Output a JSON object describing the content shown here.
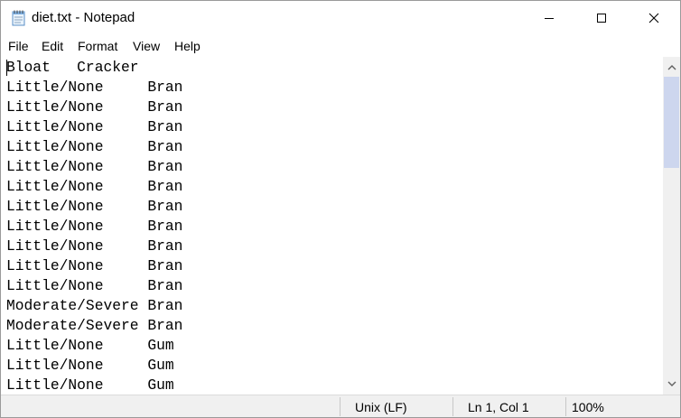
{
  "window": {
    "title": "diet.txt - Notepad",
    "controls": {
      "minimize": "minimize",
      "maximize": "maximize",
      "close": "close"
    }
  },
  "menu": [
    "File",
    "Edit",
    "Format",
    "View",
    "Help"
  ],
  "document": {
    "lines": [
      "Bloat   Cracker",
      "Little/None     Bran",
      "Little/None     Bran",
      "Little/None     Bran",
      "Little/None     Bran",
      "Little/None     Bran",
      "Little/None     Bran",
      "Little/None     Bran",
      "Little/None     Bran",
      "Little/None     Bran",
      "Little/None     Bran",
      "Little/None     Bran",
      "Moderate/Severe Bran",
      "Moderate/Severe Bran",
      "Little/None     Gum",
      "Little/None     Gum",
      "Little/None     Gum"
    ]
  },
  "status": {
    "line_ending": "Unix (LF)",
    "cursor": "Ln 1, Col 1",
    "zoom": "100%"
  },
  "icons": {
    "app": "notepad-icon",
    "minimize": "minimize-icon",
    "maximize": "maximize-icon",
    "close": "close-icon",
    "scroll_up": "chevron-up-icon",
    "scroll_down": "chevron-down-icon"
  },
  "colors": {
    "scroll_thumb": "#cdd6ee",
    "statusbar": "#f0f0f0"
  }
}
